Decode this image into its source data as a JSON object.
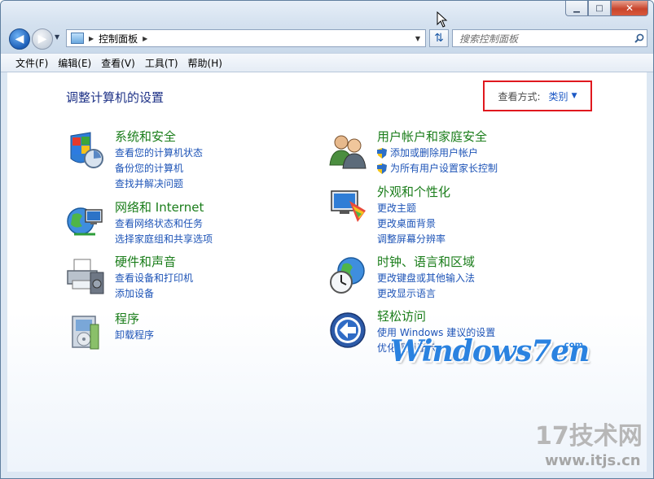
{
  "window": {
    "caption_min": "▁",
    "caption_max": "□",
    "caption_close": "✕"
  },
  "nav": {
    "back_glyph": "◀",
    "forward_glyph": "▶",
    "breadcrumb": "控制面板",
    "search_placeholder": "搜索控制面板"
  },
  "menu": [
    "文件(F)",
    "编辑(E)",
    "查看(V)",
    "工具(T)",
    "帮助(H)"
  ],
  "page": {
    "title": "调整计算机的设置",
    "view_label": "查看方式:",
    "view_value": "类别"
  },
  "categories": [
    {
      "title": "系统和安全",
      "icon": "system-security-icon",
      "links": [
        "查看您的计算机状态",
        "备份您的计算机",
        "查找并解决问题"
      ]
    },
    {
      "title": "网络和 Internet",
      "icon": "network-icon",
      "links": [
        "查看网络状态和任务",
        "选择家庭组和共享选项"
      ]
    },
    {
      "title": "硬件和声音",
      "icon": "printer-icon",
      "links": [
        "查看设备和打印机",
        "添加设备"
      ]
    },
    {
      "title": "程序",
      "icon": "programs-icon",
      "links": [
        "卸载程序"
      ]
    },
    {
      "title": "用户帐户和家庭安全",
      "icon": "users-icon",
      "links": [
        "添加或删除用户帐户",
        "为所有用户设置家长控制"
      ]
    },
    {
      "title": "外观和个性化",
      "icon": "appearance-icon",
      "links": [
        "更改主题",
        "更改桌面背景",
        "调整屏幕分辨率"
      ]
    },
    {
      "title": "时钟、语言和区域",
      "icon": "clock-globe-icon",
      "links": [
        "更改键盘或其他输入法",
        "更改显示语言"
      ]
    },
    {
      "title": "轻松访问",
      "icon": "ease-of-access-icon",
      "links": [
        "使用 Windows 建议的设置",
        "优化视频显示"
      ]
    }
  ],
  "watermark": {
    "brand": "Windows7en",
    "brand_suffix": ".com",
    "site": "17技术网",
    "url": "www.itjs.cn"
  }
}
